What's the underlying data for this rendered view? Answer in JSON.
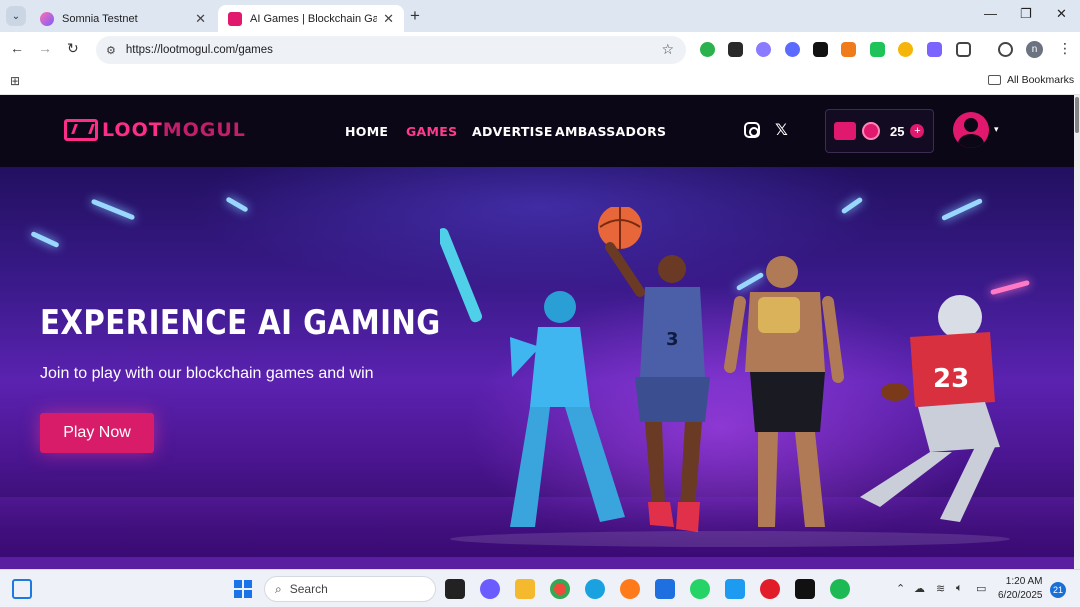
{
  "browser": {
    "tabs": [
      {
        "title": "Somnia Testnet",
        "active": false
      },
      {
        "title": "AI Games | Blockchain Games |",
        "active": true
      }
    ],
    "url": "https://lootmogul.com/games",
    "bookmarks_label": "All Bookmarks",
    "profile_initial": "n"
  },
  "site": {
    "logo": {
      "part1": "LOOT",
      "part2": "MOGUL"
    },
    "nav": [
      "HOME",
      "GAMES",
      "ADVERTISE",
      "AMBASSADORS"
    ],
    "active_nav": "GAMES",
    "wallet_count": "25",
    "accent": "#e0196e"
  },
  "hero": {
    "title": "EXPERIENCE AI GAMING",
    "subtitle": "Join to play with our blockchain games and win",
    "cta": "Play Now"
  },
  "taskbar": {
    "search_placeholder": "Search",
    "time": "1:20 AM",
    "date": "6/20/2025",
    "notifications": "21"
  }
}
